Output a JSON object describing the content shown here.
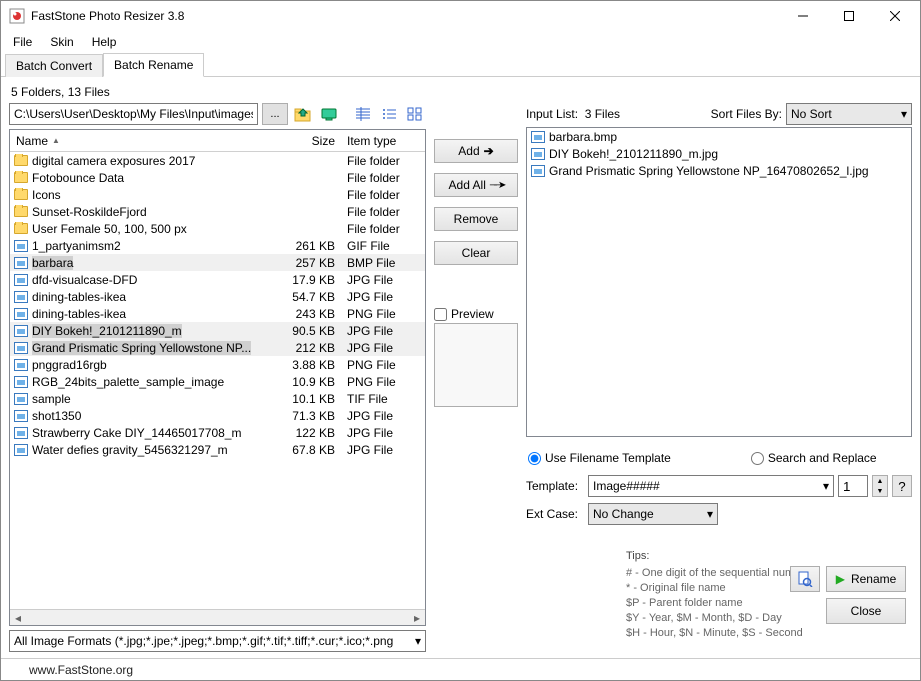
{
  "window": {
    "title": "FastStone Photo Resizer 3.8",
    "menu": [
      "File",
      "Skin",
      "Help"
    ]
  },
  "tabs": [
    {
      "label": "Batch Convert",
      "active": false
    },
    {
      "label": "Batch Rename",
      "active": true
    }
  ],
  "counts": "5 Folders, 13 Files",
  "path": "C:\\Users\\User\\Desktop\\My Files\\Input\\images\\",
  "browse_btn": "...",
  "columns": {
    "name": "Name",
    "size": "Size",
    "type": "Item type"
  },
  "files": [
    {
      "name": "digital camera exposures 2017",
      "size": "",
      "type": "File folder",
      "icon": "folder",
      "selected": false
    },
    {
      "name": "Fotobounce Data",
      "size": "",
      "type": "File folder",
      "icon": "folder",
      "selected": false
    },
    {
      "name": "Icons",
      "size": "",
      "type": "File folder",
      "icon": "folder",
      "selected": false
    },
    {
      "name": "Sunset-RoskildeFjord",
      "size": "",
      "type": "File folder",
      "icon": "folder",
      "selected": false
    },
    {
      "name": "User Female 50, 100, 500 px",
      "size": "",
      "type": "File folder",
      "icon": "folder",
      "selected": false
    },
    {
      "name": "1_partyanimsm2",
      "size": "261 KB",
      "type": "GIF File",
      "icon": "img",
      "selected": false
    },
    {
      "name": "barbara",
      "size": "257 KB",
      "type": "BMP File",
      "icon": "img",
      "selected": true
    },
    {
      "name": "dfd-visualcase-DFD",
      "size": "17.9 KB",
      "type": "JPG File",
      "icon": "img",
      "selected": false
    },
    {
      "name": "dining-tables-ikea",
      "size": "54.7 KB",
      "type": "JPG File",
      "icon": "img",
      "selected": false
    },
    {
      "name": "dining-tables-ikea",
      "size": "243 KB",
      "type": "PNG File",
      "icon": "img",
      "selected": false
    },
    {
      "name": "DIY Bokeh!_2101211890_m",
      "size": "90.5 KB",
      "type": "JPG File",
      "icon": "img",
      "selected": true
    },
    {
      "name": "Grand Prismatic Spring Yellowstone NP...",
      "size": "212 KB",
      "type": "JPG File",
      "icon": "img",
      "selected": true
    },
    {
      "name": "pnggrad16rgb",
      "size": "3.88 KB",
      "type": "PNG File",
      "icon": "img",
      "selected": false
    },
    {
      "name": "RGB_24bits_palette_sample_image",
      "size": "10.9 KB",
      "type": "PNG File",
      "icon": "img",
      "selected": false
    },
    {
      "name": "sample",
      "size": "10.1 KB",
      "type": "TIF File",
      "icon": "img",
      "selected": false
    },
    {
      "name": "shot1350",
      "size": "71.3 KB",
      "type": "JPG File",
      "icon": "img",
      "selected": false
    },
    {
      "name": "Strawberry Cake DIY_14465017708_m",
      "size": "122 KB",
      "type": "JPG File",
      "icon": "img",
      "selected": false
    },
    {
      "name": "Water defies gravity_5456321297_m",
      "size": "67.8 KB",
      "type": "JPG File",
      "icon": "img",
      "selected": false
    }
  ],
  "format_filter": "All Image Formats (*.jpg;*.jpe;*.jpeg;*.bmp;*.gif;*.tif;*.tiff;*.cur;*.ico;*.png",
  "buttons": {
    "add": "Add",
    "add_all": "Add All",
    "remove": "Remove",
    "clear": "Clear",
    "preview_chk": "Preview",
    "rename": "Rename",
    "close": "Close"
  },
  "input_list": {
    "label": "Input List:",
    "count": "3 Files",
    "sort_label": "Sort Files By:",
    "sort_value": "No Sort",
    "items": [
      "barbara.bmp",
      "DIY Bokeh!_2101211890_m.jpg",
      "Grand Prismatic Spring Yellowstone NP_16470802652_l.jpg"
    ]
  },
  "mode": {
    "template": "Use Filename Template",
    "search": "Search and Replace"
  },
  "template": {
    "label": "Template:",
    "value": "Image#####",
    "start": "1",
    "help": "?"
  },
  "extcase": {
    "label": "Ext Case:",
    "value": "No Change"
  },
  "tips": {
    "heading": "Tips:",
    "lines": [
      "#  - One digit of the sequential number",
      "*   - Original file name",
      "$P - Parent folder name",
      "$Y - Year,     $M - Month,     $D - Day",
      "$H - Hour,     $N - Minute,     $S - Second"
    ]
  },
  "status": "www.FastStone.org"
}
